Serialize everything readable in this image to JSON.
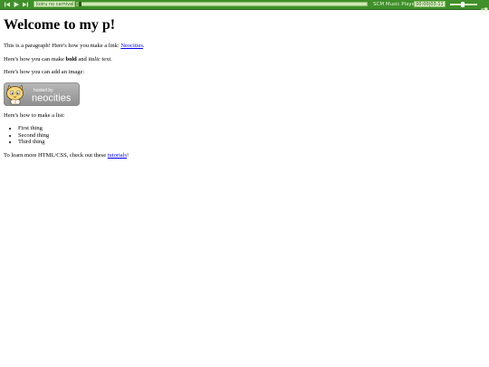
{
  "player": {
    "track": "koiru no carnival",
    "name": "SCM Music Player",
    "time": "00:00|03:11",
    "progress_fraction": 0.01,
    "volume_fraction": 0.45,
    "colors": {
      "bar": "#3f8f2a",
      "box": "#d9efc2",
      "text": "#e8f5d8"
    },
    "icons": [
      "previous-icon",
      "play-icon",
      "next-icon",
      "popout-icon"
    ]
  },
  "page": {
    "heading": "Welcome to my p!",
    "p1_text": "This is a paragraph! Here's how you make a link: ",
    "p1_link": "Neocities",
    "p1_end": ".",
    "p2_a": "Here's how you can make ",
    "p2_bold": "bold",
    "p2_b": " and ",
    "p2_italic": "italic",
    "p2_c": " text.",
    "p3": "Here's how you can add an image:",
    "logo_small": "hosted by",
    "logo_big": "neocities",
    "p4": "Here's how to make a list:",
    "list": [
      "First thing",
      "Second thing",
      "Third thing"
    ],
    "p5_text": "To learn more HTML/CSS, check out these ",
    "p5_link": "tutorials",
    "p5_end": "!"
  }
}
